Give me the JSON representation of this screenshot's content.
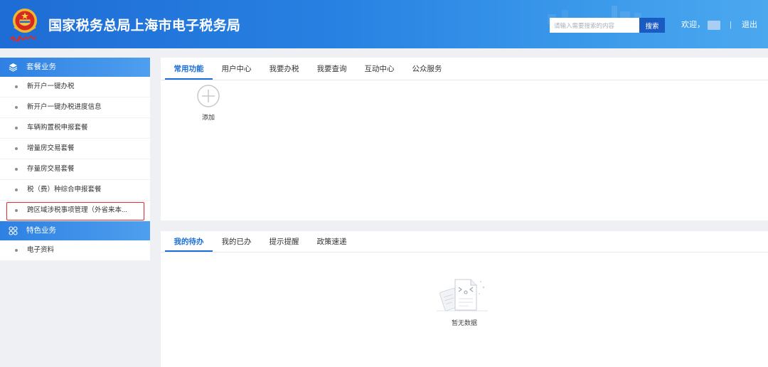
{
  "header": {
    "title": "国家税务总局上海市电子税务局",
    "logo_icon": "tax-emblem-icon",
    "search": {
      "placeholder": "请输入需要搜索的内容",
      "button_label": "搜索"
    },
    "user": {
      "welcome": "欢迎，",
      "separator": "|",
      "logout": "退出"
    }
  },
  "sidebar": {
    "sections": [
      {
        "title": "套餐业务",
        "icon": "layers-icon",
        "items": [
          "新开户一键办税",
          "新开户一键办税进度信息",
          "车辆购置税申报套餐",
          "增量房交易套餐",
          "存量房交易套餐",
          "税（费）种综合申报套餐",
          "跨区域涉税事项管理（外省来本..."
        ],
        "highlighted_item": 6
      },
      {
        "title": "特色业务",
        "icon": "four-circles-icon",
        "items": [
          "电子资料"
        ]
      }
    ]
  },
  "main": {
    "common": {
      "tabs": [
        "常用功能",
        "用户中心",
        "我要办税",
        "我要查询",
        "互动中心",
        "公众服务"
      ],
      "active_tab": 0,
      "add_icon": "plus-circle-icon",
      "add_label": "添加"
    },
    "tasks": {
      "tabs": [
        "我的待办",
        "我的已办",
        "提示提醒",
        "政策速递"
      ],
      "active_tab": 0,
      "empty_icon": "empty-document-icon",
      "empty_text": "暂无数据"
    }
  },
  "colors": {
    "header_start": "#1e6cd5",
    "header_end": "#4ba8ef",
    "accent": "#1b6ed5",
    "search_button": "#1a5bc2",
    "section_header": "#2e80e3",
    "highlight_border": "#e5262b",
    "page_background": "#eef0f4"
  }
}
